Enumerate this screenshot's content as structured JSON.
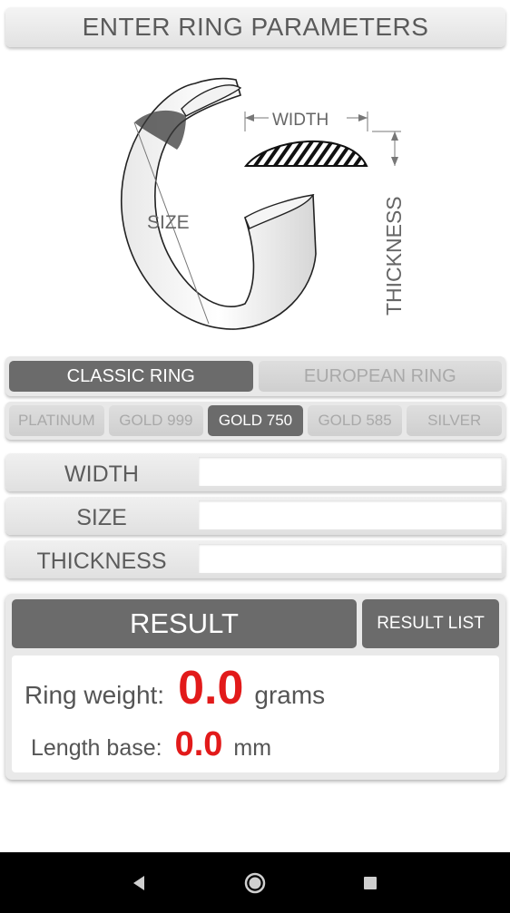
{
  "header": {
    "title": "ENTER RING PARAMETERS"
  },
  "diagram": {
    "width_label": "WIDTH",
    "size_label": "SIZE",
    "thickness_label": "THICKNESS"
  },
  "ring_type": {
    "options": [
      "CLASSIC RING",
      "EUROPEAN RING"
    ],
    "selected": "CLASSIC RING"
  },
  "metal": {
    "options": [
      "PLATINUM",
      "GOLD 999",
      "GOLD 750",
      "GOLD 585",
      "SILVER"
    ],
    "selected": "GOLD 750"
  },
  "fields": {
    "width_label": "WIDTH",
    "width_value": "",
    "size_label": "SIZE",
    "size_value": "",
    "thickness_label": "THICKNESS",
    "thickness_value": ""
  },
  "result": {
    "button_label": "RESULT",
    "list_button_label": "RESULT LIST",
    "weight_label": "Ring weight:",
    "weight_value": "0.0",
    "weight_unit": "grams",
    "length_label": "Length base:",
    "length_value": "0.0",
    "length_unit": "mm"
  },
  "colors": {
    "accent_value": "#e21a1a",
    "active_segment": "#6b6b6b",
    "inactive_segment": "#d6d6d6"
  },
  "navbar": {
    "icons": [
      "back-icon",
      "home-icon",
      "recents-icon"
    ]
  }
}
